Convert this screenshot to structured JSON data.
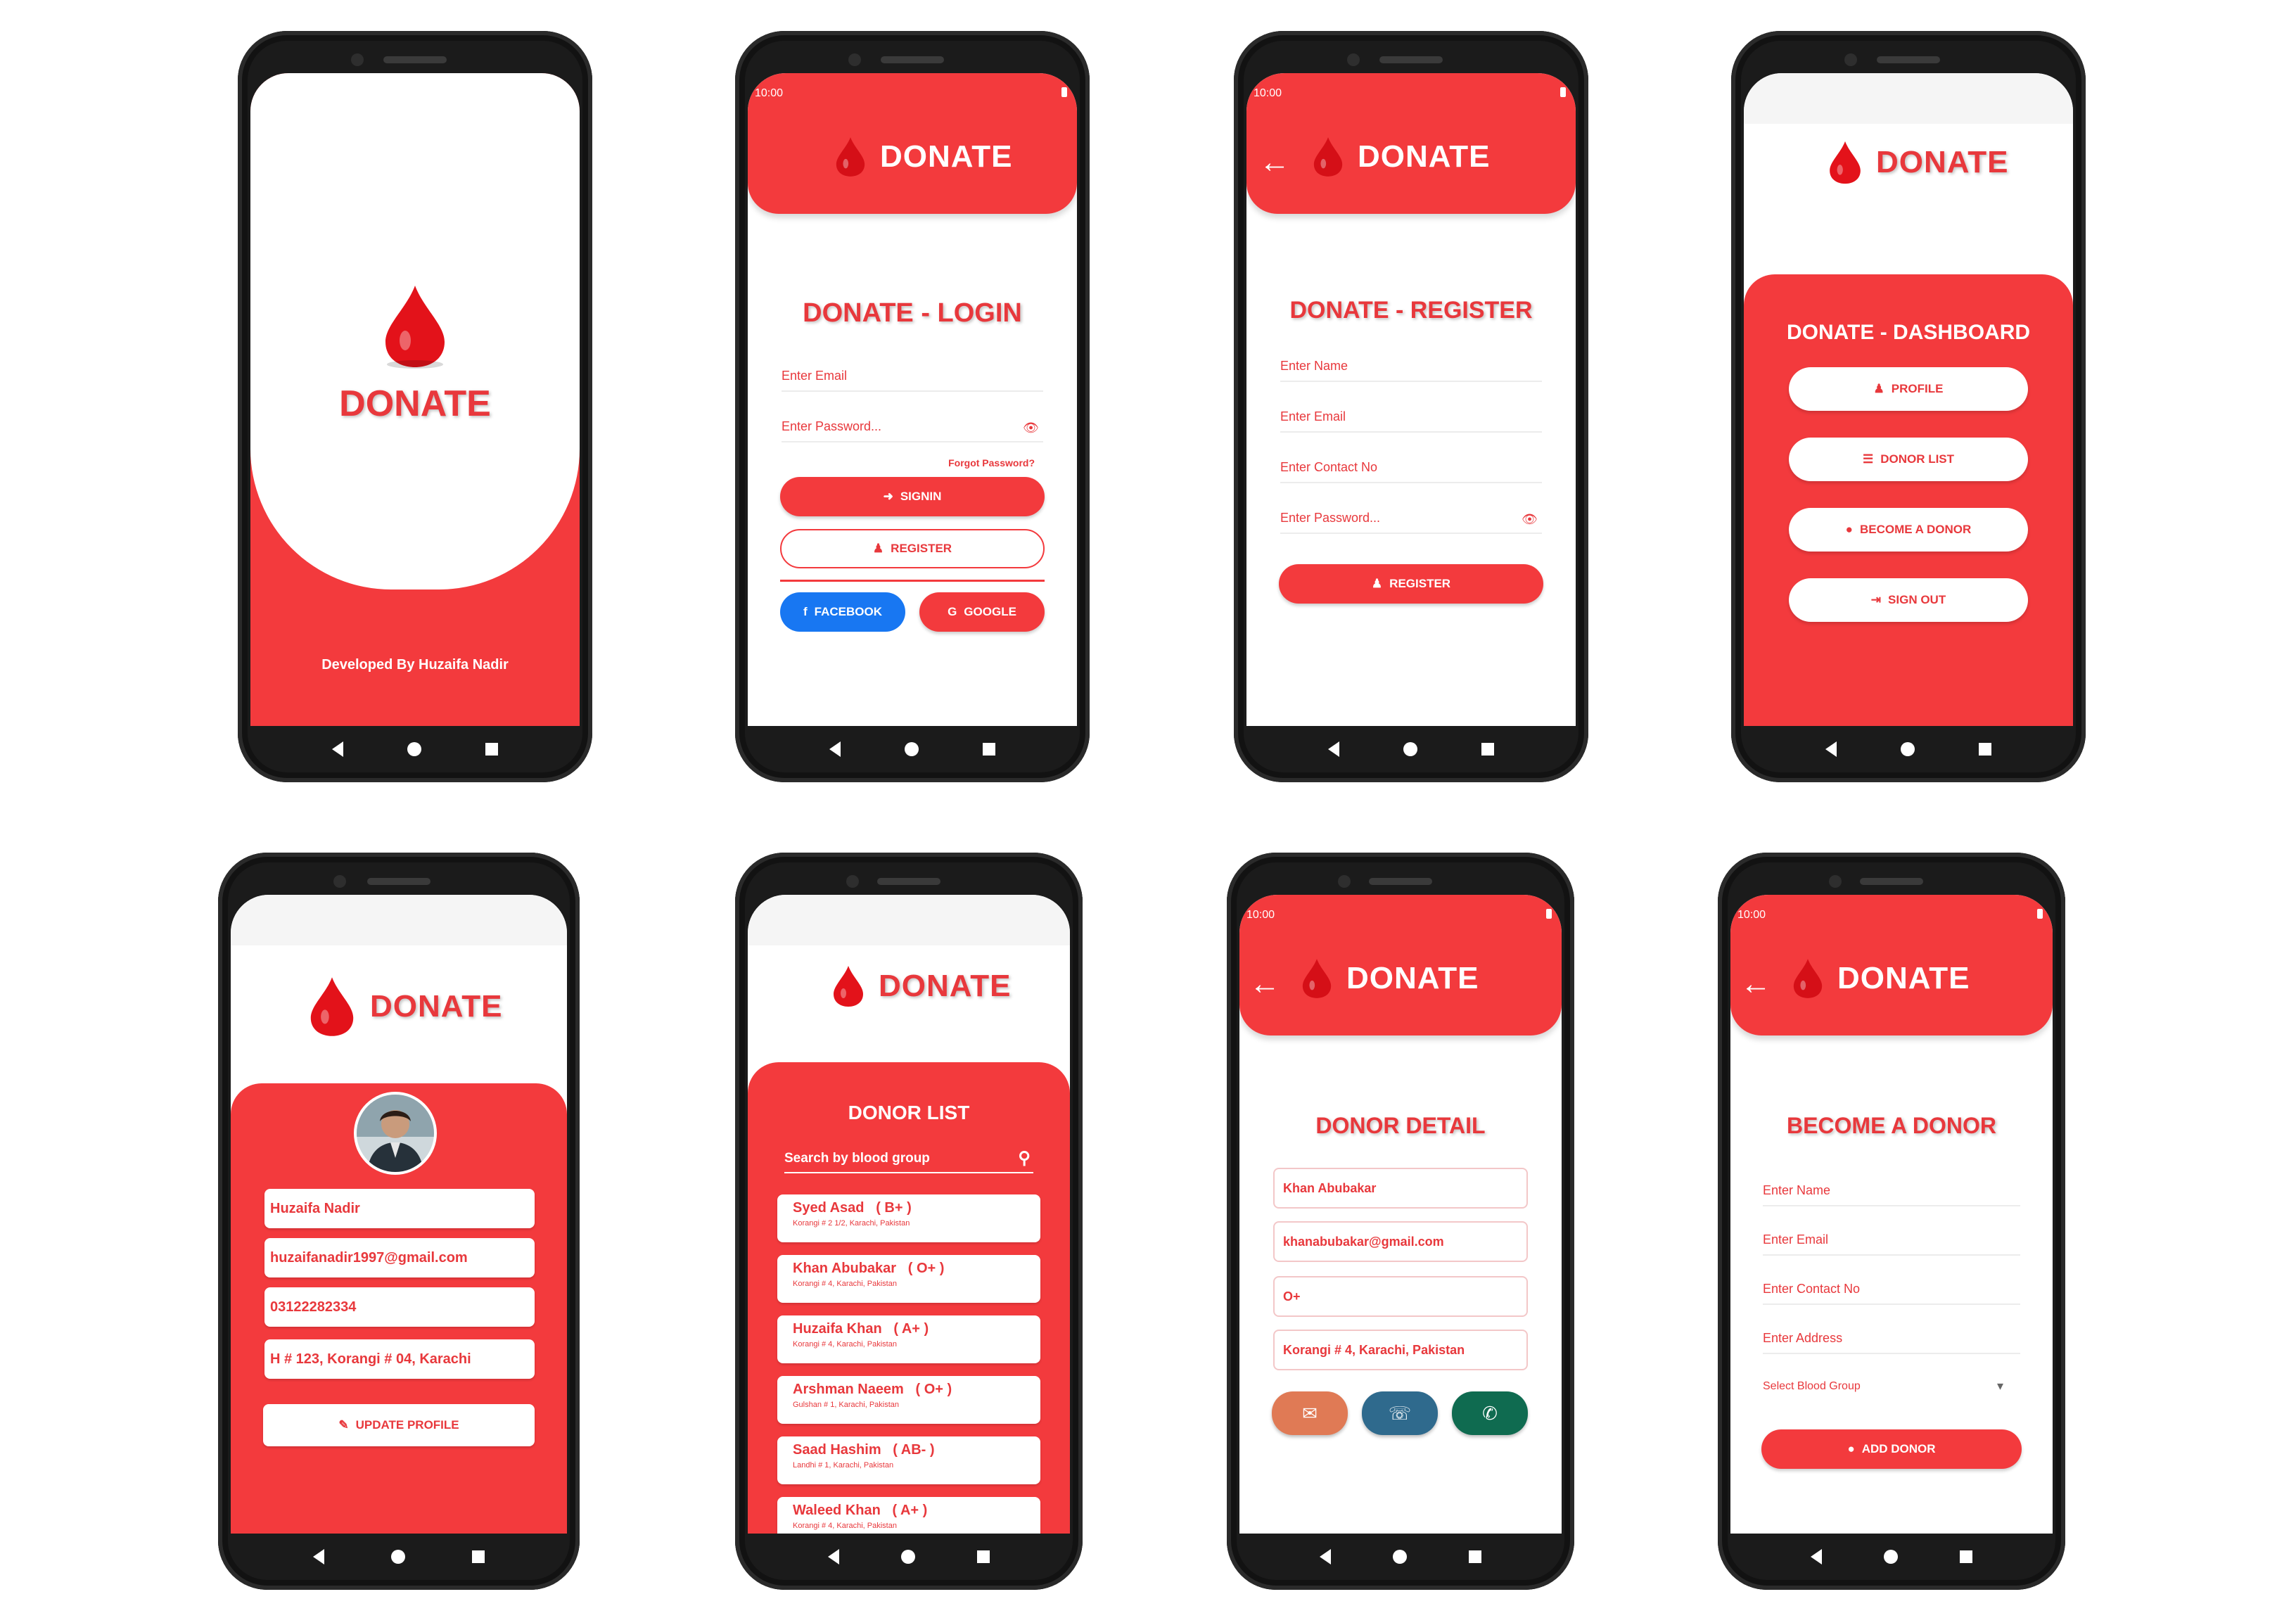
{
  "brand": "DONATE",
  "status_time": "10:00",
  "splash": {
    "brand": "DONATE",
    "footer": "Developed By Huzaifa Nadir"
  },
  "login": {
    "title": "DONATE - LOGIN",
    "email_placeholder": "Enter Email",
    "password_placeholder": "Enter Password...",
    "forgot": "Forgot Password?",
    "signin": "SIGNIN",
    "register": "REGISTER",
    "facebook": "FACEBOOK",
    "google": "GOOGLE"
  },
  "register": {
    "title": "DONATE - REGISTER",
    "name_placeholder": "Enter Name",
    "email_placeholder": "Enter Email",
    "contact_placeholder": "Enter Contact No",
    "password_placeholder": "Enter Password...",
    "register": "REGISTER"
  },
  "dashboard": {
    "title": "DONATE - DASHBOARD",
    "profile": "PROFILE",
    "donor_list": "DONOR LIST",
    "become": "BECOME A DONOR",
    "sign_out": "SIGN OUT"
  },
  "profile": {
    "name": "Huzaifa Nadir",
    "email": "huzaifanadir1997@gmail.com",
    "phone": "03122282334",
    "address": "H # 123, Korangi # 04, Karachi",
    "update": "UPDATE PROFILE"
  },
  "donor_list": {
    "title": "DONOR LIST",
    "search_placeholder": "Search by blood group",
    "donors": [
      {
        "name": "Syed Asad",
        "group": "( B+ )",
        "address": "Korangi # 2 1/2, Karachi, Pakistan"
      },
      {
        "name": "Khan Abubakar",
        "group": "( O+ )",
        "address": "Korangi # 4, Karachi, Pakistan"
      },
      {
        "name": "Huzaifa Khan",
        "group": "( A+ )",
        "address": "Korangi # 4, Karachi, Pakistan"
      },
      {
        "name": "Arshman Naeem",
        "group": "( O+ )",
        "address": "Gulshan # 1, Karachi, Pakistan"
      },
      {
        "name": "Saad Hashim",
        "group": "( AB- )",
        "address": "Landhi # 1, Karachi, Pakistan"
      },
      {
        "name": "Waleed Khan",
        "group": "( A+ )",
        "address": "Korangi # 4, Karachi, Pakistan"
      }
    ]
  },
  "donor_detail": {
    "title": "DONOR DETAIL",
    "name": "Khan Abubakar",
    "email": "khanabubakar@gmail.com",
    "group": "O+",
    "address": "Korangi # 4, Karachi, Pakistan"
  },
  "become": {
    "title": "BECOME A DONOR",
    "name_placeholder": "Enter Name",
    "email_placeholder": "Enter Email",
    "contact_placeholder": "Enter Contact No",
    "address_placeholder": "Enter Address",
    "blood_placeholder": "Select Blood Group",
    "add": "ADD DONOR"
  },
  "icons": {
    "eye": "👁",
    "signin": "➜",
    "user": "♟",
    "facebook": "f",
    "google": "G",
    "list": "☰",
    "drop": "●",
    "signout": "⇥",
    "edit": "✎",
    "search": "⚲",
    "mail": "✉",
    "phone": "☏",
    "whatsapp": "✆",
    "dropdown": "▾",
    "back": "←"
  },
  "colors": {
    "primary": "#f33a3d",
    "text_red": "#e8383c",
    "mail_btn": "#e07a55",
    "phone_btn": "#2f6a8d",
    "whatsapp_btn": "#0f6b50"
  }
}
